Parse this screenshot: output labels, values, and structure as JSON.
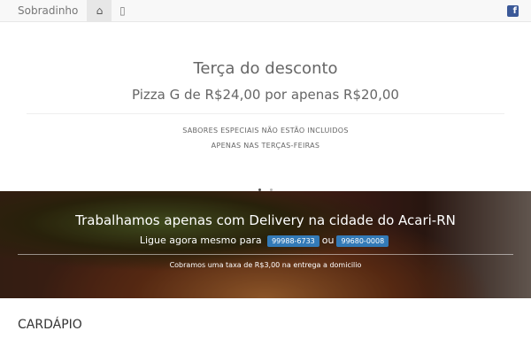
{
  "nav": {
    "brand": "Sobradinho",
    "home_icon": "🏠",
    "bookmark_icon": "🔖",
    "facebook_icon": "f"
  },
  "promo": {
    "title": "Terça do desconto",
    "subtitle": "Pizza G de R$24,00 por apenas R$20,00",
    "note1": "SABORES ESPECIAIS NÃO ESTÃO INCLUIDOS",
    "note2": "APENAS NAS TERÇAS-FEIRAS"
  },
  "hero": {
    "headline": "Trabalhamos apenas com Delivery na cidade do Acari-RN",
    "call_prefix": "Ligue agora mesmo para",
    "phone1": "99988-6733",
    "or": "ou",
    "phone2": "99680-0008",
    "fee": "Cobramos uma taxa de R$3,00 na entrega a domicilio"
  },
  "menu": {
    "title": "CARDÁPIO"
  }
}
